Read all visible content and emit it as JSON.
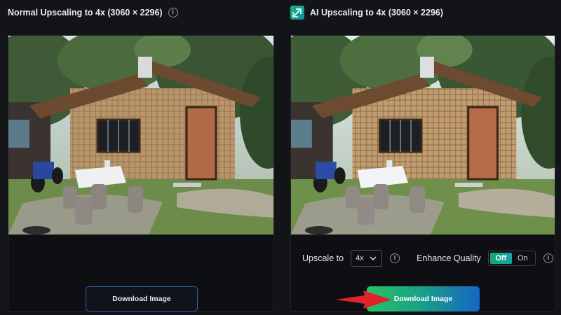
{
  "left_panel": {
    "title": "Normal Upscaling to 4x (3060 × 2296)",
    "info_glyph": "i",
    "image_alt": "bamboo hut photo – normal upscale",
    "download_label": "Download Image"
  },
  "right_panel": {
    "title": "AI Upscaling to 4x (3060 × 2296)",
    "icon": "ai-upscale-icon",
    "image_alt": "bamboo hut photo – AI upscale",
    "upscale_label": "Upscale to",
    "upscale_value": "4x",
    "info_glyph": "i",
    "enhance_label": "Enhance Quality",
    "toggle_off": "Off",
    "toggle_on": "On",
    "toggle_state": "Off",
    "download_label": "Download Image"
  },
  "colors": {
    "background": "#121418",
    "accent_green": "#12a86e",
    "accent_blue": "#1566c4",
    "arrow_red": "#e0222b"
  }
}
